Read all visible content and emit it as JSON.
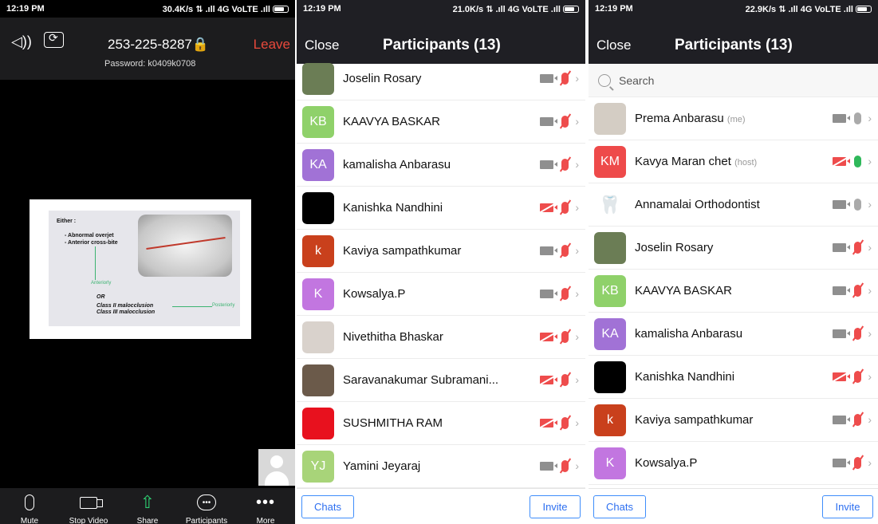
{
  "panel1": {
    "status": {
      "time": "12:19 PM",
      "net": "30.4K/s ⇅ .ıll 4G VoLTE .ıll"
    },
    "header": {
      "speaker_icon": "speaker-icon",
      "camera_flip_icon": "camera-switch-icon",
      "meeting_id": "253-225-8287🔒",
      "password": "Password: k0409k0708",
      "leave": "Leave"
    },
    "slide": {
      "line1": "Either :",
      "line2": "- Abnormal overjet",
      "line3": "- Anterior cross-bite",
      "anteriorly": "Anteriorly",
      "or": "OR",
      "class2": "Class II malocclusion",
      "class3": "Class III malocclusion",
      "posteriorly": "Posteriorly"
    },
    "toolbar": [
      {
        "label": "Mute",
        "icon": "microphone-icon"
      },
      {
        "label": "Stop Video",
        "icon": "video-camera-icon"
      },
      {
        "label": "Share",
        "icon": "share-icon"
      },
      {
        "label": "Participants",
        "icon": "participants-chat-icon"
      },
      {
        "label": "More",
        "icon": "more-icon"
      }
    ]
  },
  "panel2": {
    "status": {
      "time": "12:19 PM",
      "net": "21.0K/s ⇅ .ıll 4G VoLTE .ıll"
    },
    "close": "Close",
    "title": "Participants (13)",
    "participants": [
      {
        "name": "Joselin Rosary",
        "tag": "",
        "avatar_text": "",
        "avatar_color": "#6b7d55",
        "video_off": false,
        "mic": "muted"
      },
      {
        "name": "KAAVYA BASKAR",
        "tag": "",
        "avatar_text": "KB",
        "avatar_color": "#8fd16a",
        "video_off": false,
        "mic": "muted"
      },
      {
        "name": "kamalisha Anbarasu",
        "tag": "",
        "avatar_text": "KA",
        "avatar_color": "#a172d6",
        "video_off": false,
        "mic": "muted"
      },
      {
        "name": "Kanishka Nandhini",
        "tag": "",
        "avatar_text": "",
        "avatar_color": "#000000",
        "video_off": true,
        "mic": "muted"
      },
      {
        "name": "Kaviya sampathkumar",
        "tag": "",
        "avatar_text": "k",
        "avatar_color": "#c9401c",
        "video_off": false,
        "mic": "muted"
      },
      {
        "name": "Kowsalya.P",
        "tag": "",
        "avatar_text": "K",
        "avatar_color": "#c276e0",
        "video_off": false,
        "mic": "muted"
      },
      {
        "name": "Nivethitha Bhaskar",
        "tag": "",
        "avatar_text": "",
        "avatar_color": "#d9d2cc",
        "video_off": true,
        "mic": "muted"
      },
      {
        "name": "Saravanakumar Subramani...",
        "tag": "",
        "avatar_text": "",
        "avatar_color": "#6b5a4a",
        "video_off": true,
        "mic": "muted"
      },
      {
        "name": "SUSHMITHA RAM",
        "tag": "",
        "avatar_text": "",
        "avatar_color": "#e8111e",
        "video_off": true,
        "mic": "muted"
      },
      {
        "name": "Yamini Jeyaraj",
        "tag": "",
        "avatar_text": "YJ",
        "avatar_color": "#a8d479",
        "video_off": false,
        "mic": "muted"
      }
    ],
    "chats": "Chats",
    "invite": "Invite"
  },
  "panel3": {
    "status": {
      "time": "12:19 PM",
      "net": "22.9K/s ⇅ .ıll 4G VoLTE .ıll"
    },
    "close": "Close",
    "title": "Participants (13)",
    "search_placeholder": "Search",
    "participants": [
      {
        "name": "Prema Anbarasu",
        "tag": "(me)",
        "avatar_text": "",
        "avatar_color": "#d4cdc4",
        "video_off": false,
        "mic": "idle"
      },
      {
        "name": "Kavya Maran chet",
        "tag": "(host)",
        "avatar_text": "KM",
        "avatar_color": "#ee4a4a",
        "video_off": true,
        "mic": "live"
      },
      {
        "name": "Annamalai Orthodontist",
        "tag": "",
        "avatar_text": "🦷",
        "avatar_color": "#ffffff",
        "video_off": false,
        "mic": "idle"
      },
      {
        "name": "Joselin Rosary",
        "tag": "",
        "avatar_text": "",
        "avatar_color": "#6b7d55",
        "video_off": false,
        "mic": "muted"
      },
      {
        "name": "KAAVYA BASKAR",
        "tag": "",
        "avatar_text": "KB",
        "avatar_color": "#8fd16a",
        "video_off": false,
        "mic": "muted"
      },
      {
        "name": "kamalisha Anbarasu",
        "tag": "",
        "avatar_text": "KA",
        "avatar_color": "#a172d6",
        "video_off": false,
        "mic": "muted"
      },
      {
        "name": "Kanishka Nandhini",
        "tag": "",
        "avatar_text": "",
        "avatar_color": "#000000",
        "video_off": true,
        "mic": "muted"
      },
      {
        "name": "Kaviya sampathkumar",
        "tag": "",
        "avatar_text": "k",
        "avatar_color": "#c9401c",
        "video_off": false,
        "mic": "muted"
      },
      {
        "name": "Kowsalya.P",
        "tag": "",
        "avatar_text": "K",
        "avatar_color": "#c276e0",
        "video_off": false,
        "mic": "muted"
      }
    ],
    "chats": "Chats",
    "invite": "Invite"
  }
}
